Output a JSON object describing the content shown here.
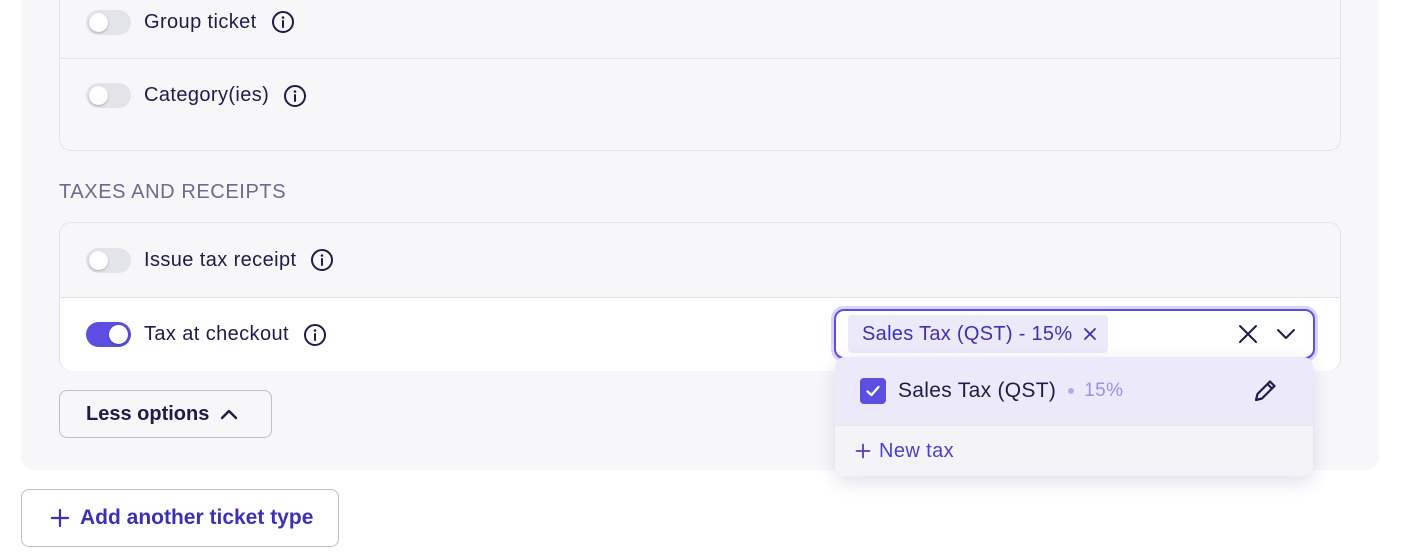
{
  "options_card": {
    "rows": [
      {
        "label": "Group ticket",
        "enabled": false
      },
      {
        "label": "Category(ies)",
        "enabled": false
      }
    ]
  },
  "taxes_section": {
    "title": "TAXES AND RECEIPTS",
    "rows": [
      {
        "label": "Issue tax receipt",
        "enabled": false
      },
      {
        "label": "Tax at checkout",
        "enabled": true
      }
    ]
  },
  "tax_select": {
    "selected_chip": "Sales Tax (QST) - 15%",
    "dropdown": {
      "options": [
        {
          "name": "Sales Tax (QST)",
          "rate": "15%",
          "checked": true
        }
      ],
      "new_tax_label": "New tax"
    }
  },
  "less_options_label": "Less options",
  "add_ticket_label": "Add another ticket type",
  "colors": {
    "accent": "#5b4ee0",
    "accent_text": "#3c31b5",
    "text": "#1d1b4b",
    "muted": "#6b6b8e",
    "panel_bg": "#f7f7fa"
  },
  "icons": {
    "info": "info-circle-icon",
    "close": "close-icon",
    "chevron_down": "chevron-down-icon",
    "chevron_up": "chevron-up-icon",
    "check": "check-icon",
    "edit": "pencil-icon",
    "plus": "plus-icon"
  }
}
